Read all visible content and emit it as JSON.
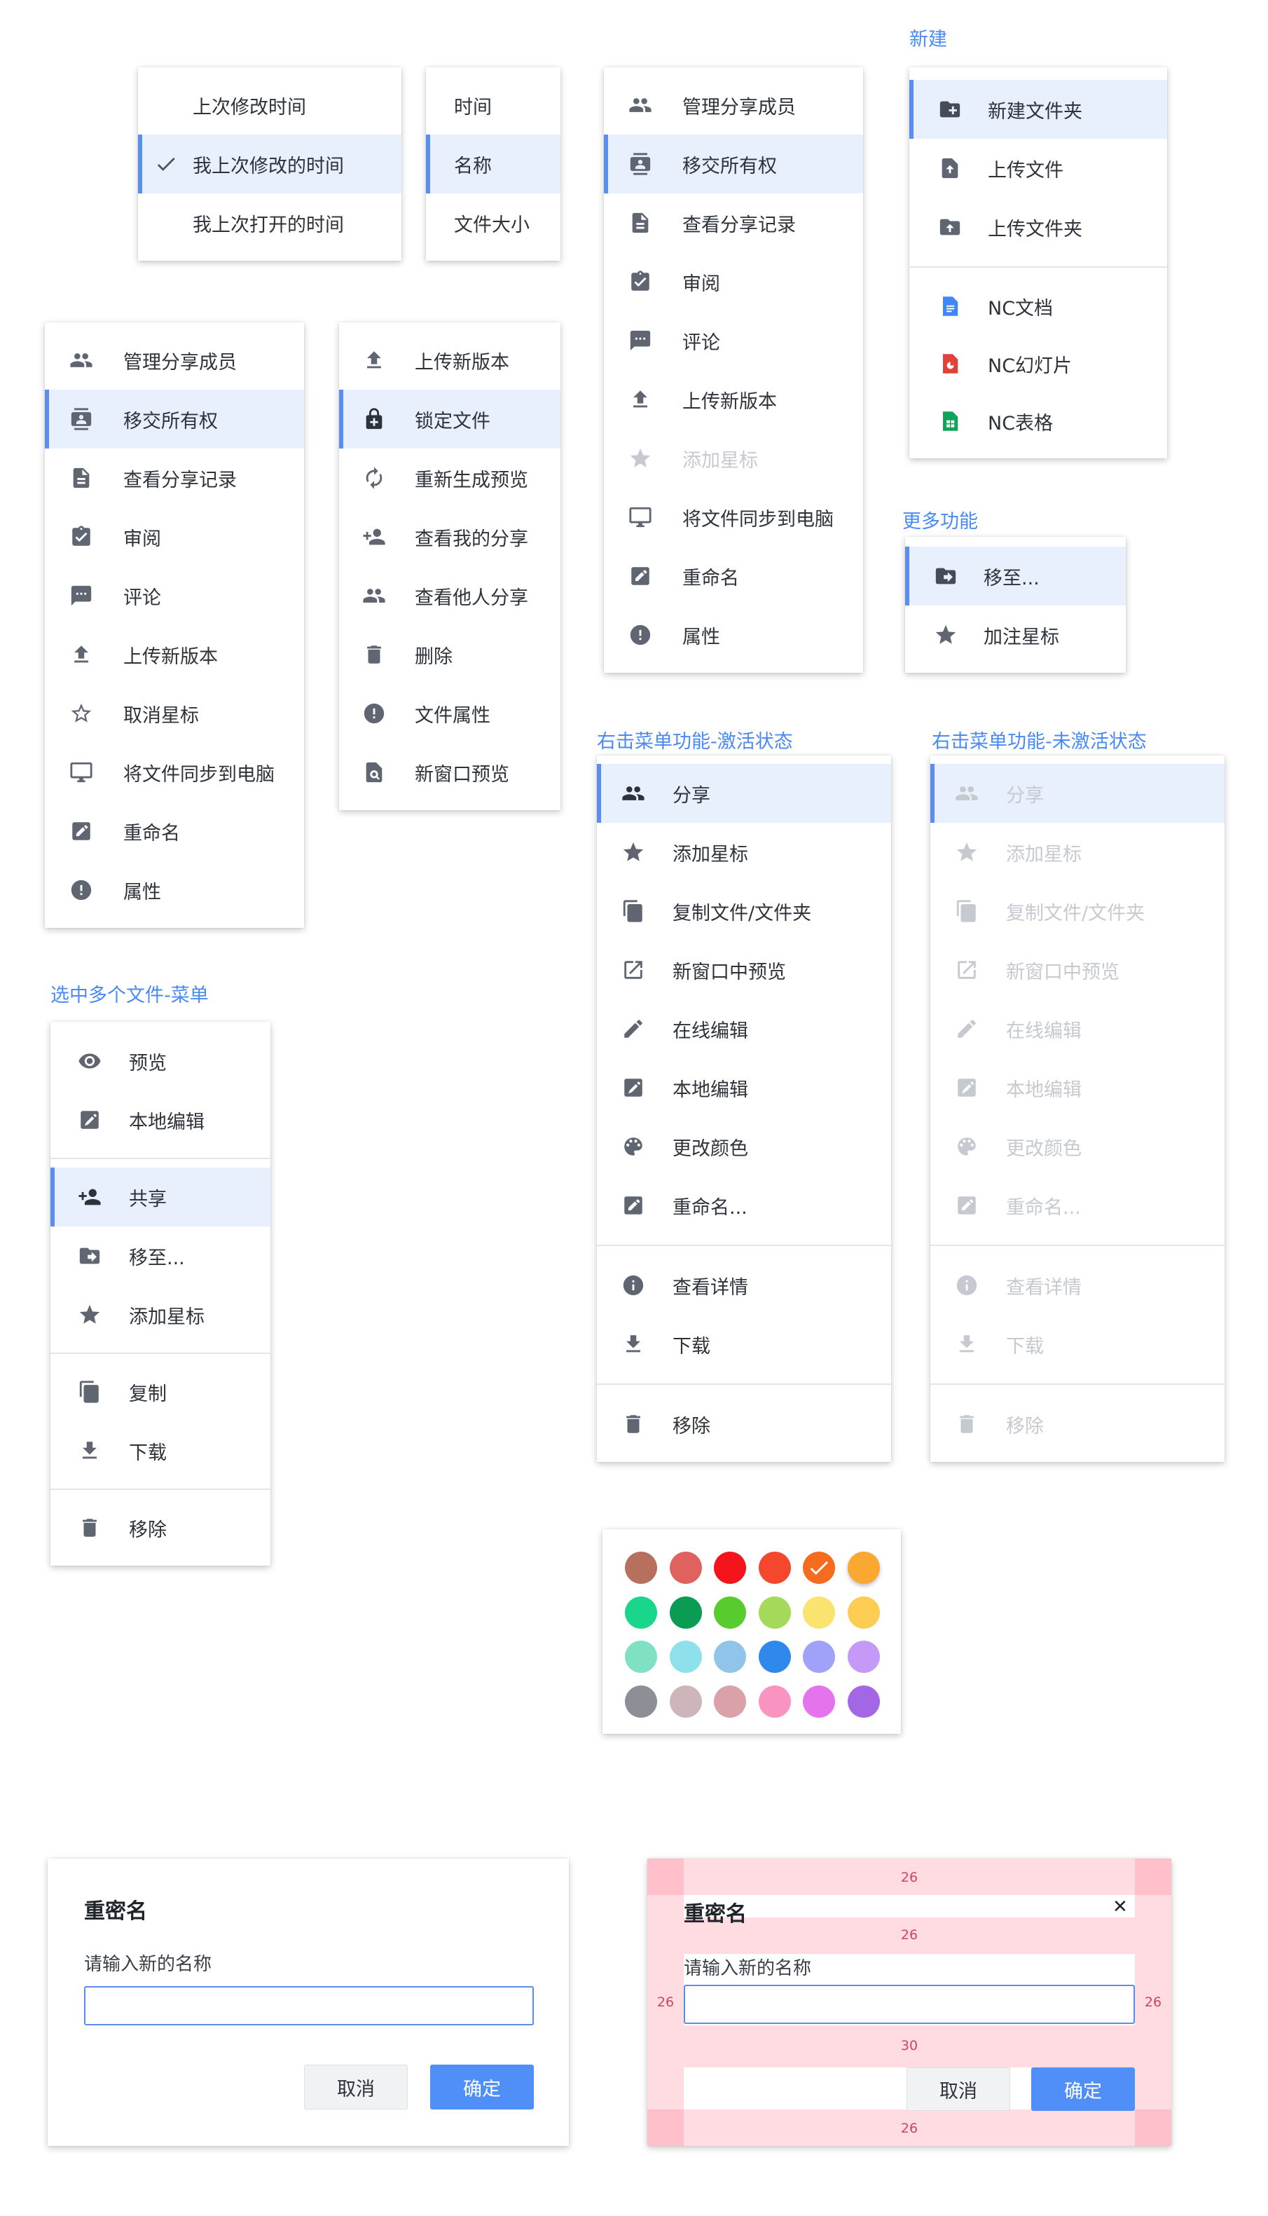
{
  "titles": {
    "new": "新建",
    "more": "更多功能",
    "ctx_active": "右击菜单功能-激活状态",
    "ctx_inactive": "右击菜单功能-未激活状态",
    "multi": "选中多个文件-菜单"
  },
  "sortDate": {
    "items": [
      "上次修改时间",
      "我上次修改的时间",
      "我上次打开的时间"
    ]
  },
  "sortBy": {
    "items": [
      "时间",
      "名称",
      "文件大小"
    ]
  },
  "menuShareA": {
    "items": [
      "管理分享成员",
      "移交所有权",
      "查看分享记录",
      "审阅",
      "评论",
      "上传新版本",
      "添加星标",
      "将文件同步到电脑",
      "重命名",
      "属性"
    ]
  },
  "menuShareB": {
    "items": [
      "管理分享成员",
      "移交所有权",
      "查看分享记录",
      "审阅",
      "评论",
      "上传新版本",
      "取消星标",
      "将文件同步到电脑",
      "重命名",
      "属性"
    ]
  },
  "menuFile": {
    "items": [
      "上传新版本",
      "锁定文件",
      "重新生成预览",
      "查看我的分享",
      "查看他人分享",
      "删除",
      "文件属性",
      "新窗口预览"
    ]
  },
  "menuNew": {
    "items": [
      "新建文件夹",
      "上传文件",
      "上传文件夹",
      "NC文档",
      "NC幻灯片",
      "NC表格"
    ]
  },
  "menuMore": {
    "items": [
      "移至...",
      "加注星标"
    ]
  },
  "ctx": {
    "items": [
      "分享",
      "添加星标",
      "复制文件/文件夹",
      "新窗口中预览",
      "在线编辑",
      "本地编辑",
      "更改颜色",
      "重命名...",
      "查看详情",
      "下载",
      "移除"
    ]
  },
  "multi": {
    "items": [
      "预览",
      "本地编辑",
      "共享",
      "移至...",
      "添加星标",
      "复制",
      "下载",
      "移除"
    ]
  },
  "palette": {
    "colors": [
      "#b8705e",
      "#df625f",
      "#f5141c",
      "#f5472d",
      "#f56c1f",
      "#fba832",
      "#1ad68a",
      "#0a9c52",
      "#58cc2f",
      "#a5d95a",
      "#fbe36f",
      "#fccd52",
      "#80e0c4",
      "#8ee1ea",
      "#90c5e9",
      "#2f89ec",
      "#9fa2f8",
      "#c499f7",
      "#8c8f95",
      "#cdb5ba",
      "#daa1a8",
      "#f993c0",
      "#e473ed",
      "#a367e6"
    ],
    "selected_index": 4
  },
  "rename": {
    "title": "重密名",
    "label": "请输入新的名称",
    "input_value": "",
    "cancel": "取消",
    "ok": "确定"
  },
  "renameSpec": {
    "title": "重密名",
    "label": "请输入新的名称",
    "cancel": "取消",
    "ok": "确定",
    "close": "✕",
    "dims": [
      "26",
      "26",
      "26",
      "26",
      "30",
      "26"
    ]
  }
}
